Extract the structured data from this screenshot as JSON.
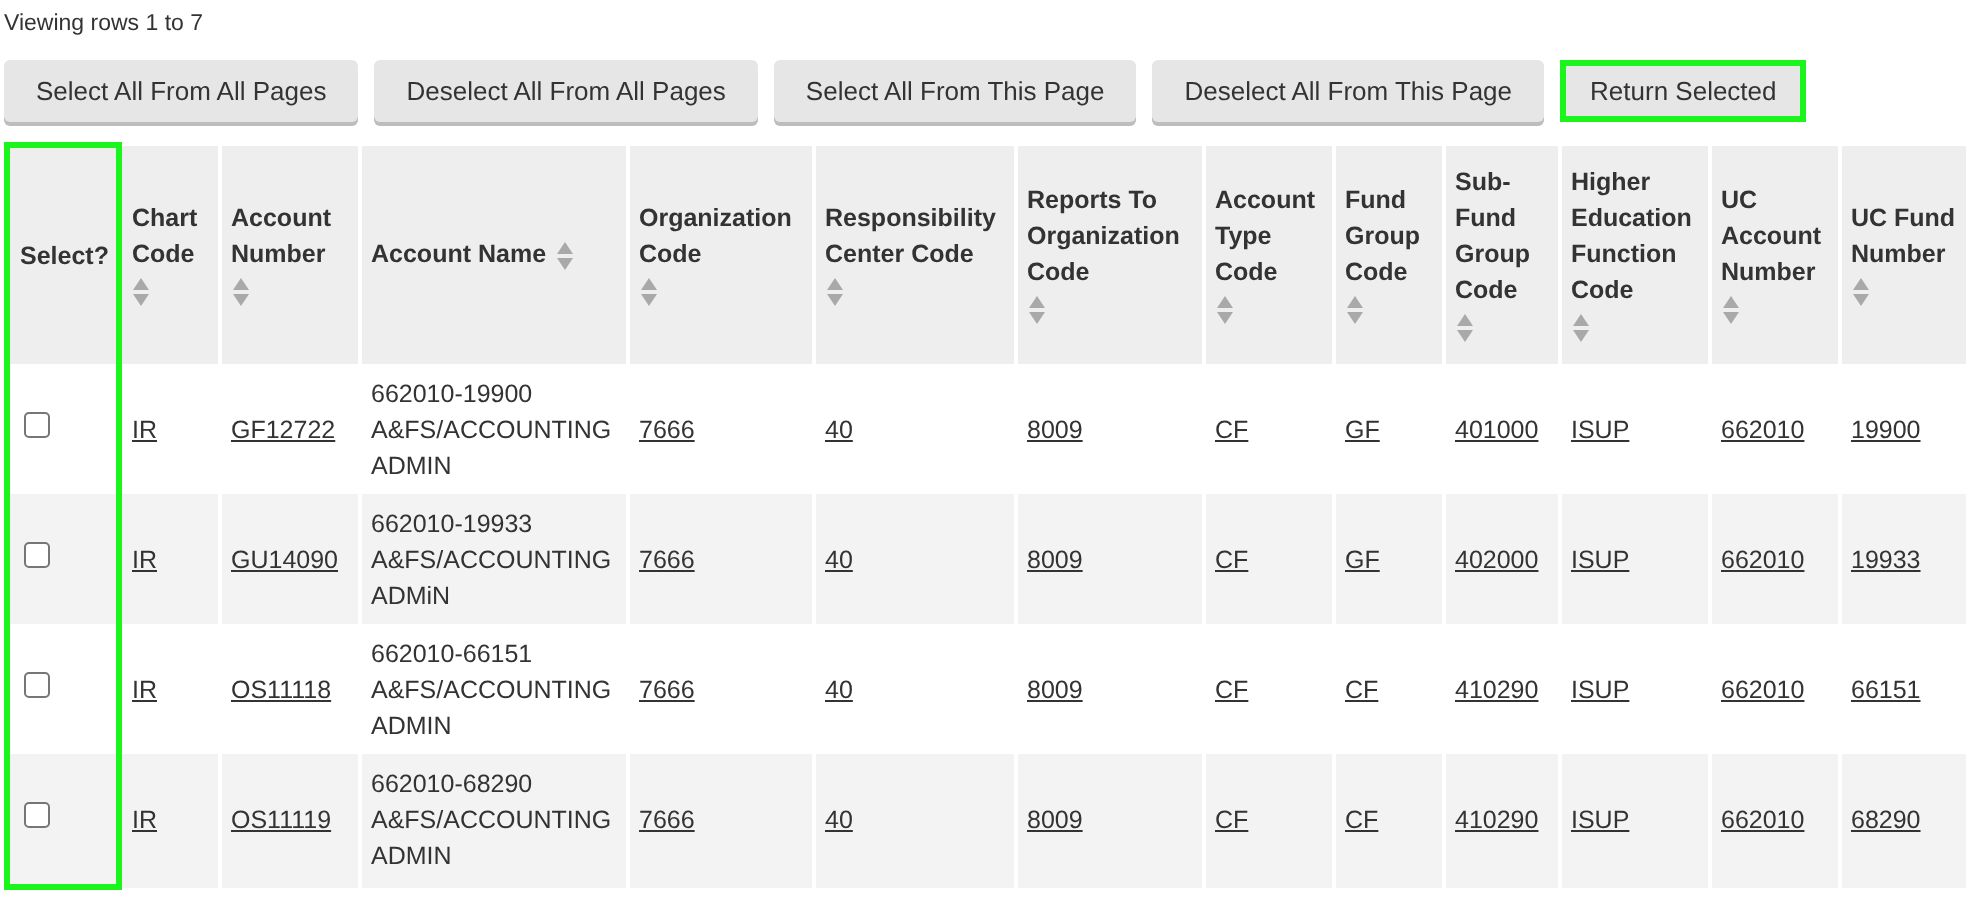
{
  "summary": "Viewing rows 1 to 7",
  "buttons": [
    {
      "label": "Select All From All Pages",
      "highlighted": false
    },
    {
      "label": "Deselect All From All Pages",
      "highlighted": false
    },
    {
      "label": "Select All From This Page",
      "highlighted": false
    },
    {
      "label": "Deselect All From This Page",
      "highlighted": false
    },
    {
      "label": "Return Selected",
      "highlighted": true
    }
  ],
  "table": {
    "columns": [
      {
        "label": "Select?",
        "kind": "checkbox",
        "sortable": false,
        "highlighted": true
      },
      {
        "label": "Chart Code",
        "kind": "link",
        "sortable": true,
        "highlighted": false
      },
      {
        "label": "Account Number",
        "kind": "link",
        "sortable": true,
        "highlighted": false
      },
      {
        "label": "Account Name",
        "kind": "text",
        "sortable": true,
        "highlighted": false
      },
      {
        "label": "Organization Code",
        "kind": "link",
        "sortable": true,
        "highlighted": false
      },
      {
        "label": "Responsibility Center Code",
        "kind": "link",
        "sortable": true,
        "highlighted": false
      },
      {
        "label": "Reports To Organization Code",
        "kind": "link",
        "sortable": true,
        "highlighted": false
      },
      {
        "label": "Account Type Code",
        "kind": "link",
        "sortable": true,
        "highlighted": false
      },
      {
        "label": "Fund Group Code",
        "kind": "link",
        "sortable": true,
        "highlighted": false
      },
      {
        "label": "Sub-Fund Group Code",
        "kind": "link",
        "sortable": true,
        "highlighted": false
      },
      {
        "label": "Higher Education Function Code",
        "kind": "link",
        "sortable": true,
        "highlighted": false
      },
      {
        "label": "UC Account Number",
        "kind": "link",
        "sortable": true,
        "highlighted": false
      },
      {
        "label": "UC Fund Number",
        "kind": "link",
        "sortable": true,
        "highlighted": false
      }
    ],
    "rows": [
      {
        "checked": false,
        "cells": [
          "",
          "IR",
          "GF12722",
          "662010-19900 A&FS/ACCOUNTING ADMIN",
          "7666",
          "40",
          "8009",
          "CF",
          "GF",
          "401000",
          "ISUP",
          "662010",
          "19900"
        ]
      },
      {
        "checked": false,
        "cells": [
          "",
          "IR",
          "GU14090",
          "662010-19933 A&FS/ACCOUNTING ADMiN",
          "7666",
          "40",
          "8009",
          "CF",
          "GF",
          "402000",
          "ISUP",
          "662010",
          "19933"
        ]
      },
      {
        "checked": false,
        "cells": [
          "",
          "IR",
          "OS11118",
          "662010-66151 A&FS/ACCOUNTING ADMIN",
          "7666",
          "40",
          "8009",
          "CF",
          "CF",
          "410290",
          "ISUP",
          "662010",
          "66151"
        ]
      },
      {
        "checked": false,
        "cells": [
          "",
          "IR",
          "OS11119",
          "662010-68290 A&FS/ACCOUNTING ADMIN",
          "7666",
          "40",
          "8009",
          "CF",
          "CF",
          "410290",
          "ISUP",
          "662010",
          "68290"
        ]
      }
    ]
  }
}
